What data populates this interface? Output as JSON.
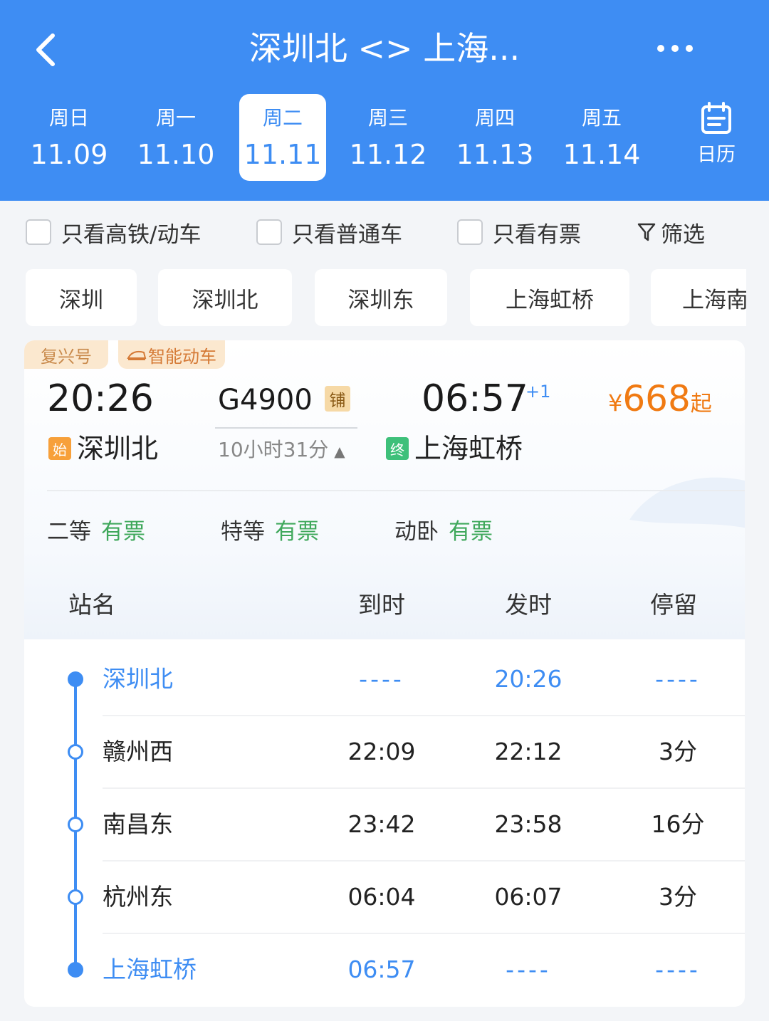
{
  "header": {
    "title": "深圳北 <> 上海...",
    "bg_color": "#3e8df3",
    "back_icon": "chevron-left-icon",
    "more_icon": "more-horizontal-icon"
  },
  "dates": [
    {
      "weekday": "周日",
      "date": "11.09",
      "active": false
    },
    {
      "weekday": "周一",
      "date": "11.10",
      "active": false
    },
    {
      "weekday": "周二",
      "date": "11.11",
      "active": true
    },
    {
      "weekday": "周三",
      "date": "11.12",
      "active": false
    },
    {
      "weekday": "周四",
      "date": "11.13",
      "active": false
    },
    {
      "weekday": "周五",
      "date": "11.14",
      "active": false
    }
  ],
  "calendar": {
    "label": "日历",
    "icon": "calendar-icon"
  },
  "filters": {
    "high_speed_only": "只看高铁/动车",
    "regular_only": "只看普通车",
    "available_only": "只看有票",
    "filter_label": "筛选",
    "filter_icon": "funnel-icon"
  },
  "station_chips": [
    "深圳",
    "深圳北",
    "深圳东",
    "上海虹桥",
    "上海南"
  ],
  "train": {
    "tag_brand": "复兴号",
    "tag_smart": "智能动车",
    "departure_time": "20:26",
    "train_number": "G4900",
    "bunk_badge": "铺",
    "arrival_time": "06:57",
    "next_day": "+1",
    "price_symbol": "¥",
    "price": "668",
    "price_suffix": "起",
    "price_color": "#f07a12",
    "departure_badge": "始",
    "departure_station": "深圳北",
    "duration": "10小时31分",
    "duration_toggle": "▲",
    "arrival_badge": "终",
    "arrival_station": "上海虹桥",
    "seats": [
      {
        "class": "二等",
        "status": "有票"
      },
      {
        "class": "特等",
        "status": "有票"
      },
      {
        "class": "动卧",
        "status": "有票"
      }
    ]
  },
  "stops_table": {
    "headers": {
      "station": "站名",
      "arrive": "到时",
      "depart": "发时",
      "stay": "停留"
    },
    "rows": [
      {
        "station": "深圳北",
        "arrive": "----",
        "depart": "20:26",
        "stay": "----",
        "highlight": true
      },
      {
        "station": "赣州西",
        "arrive": "22:09",
        "depart": "22:12",
        "stay": "3分",
        "highlight": false
      },
      {
        "station": "南昌东",
        "arrive": "23:42",
        "depart": "23:58",
        "stay": "16分",
        "highlight": false
      },
      {
        "station": "杭州东",
        "arrive": "06:04",
        "depart": "06:07",
        "stay": "3分",
        "highlight": false
      },
      {
        "station": "上海虹桥",
        "arrive": "06:57",
        "depart": "----",
        "stay": "----",
        "highlight": true
      }
    ]
  }
}
